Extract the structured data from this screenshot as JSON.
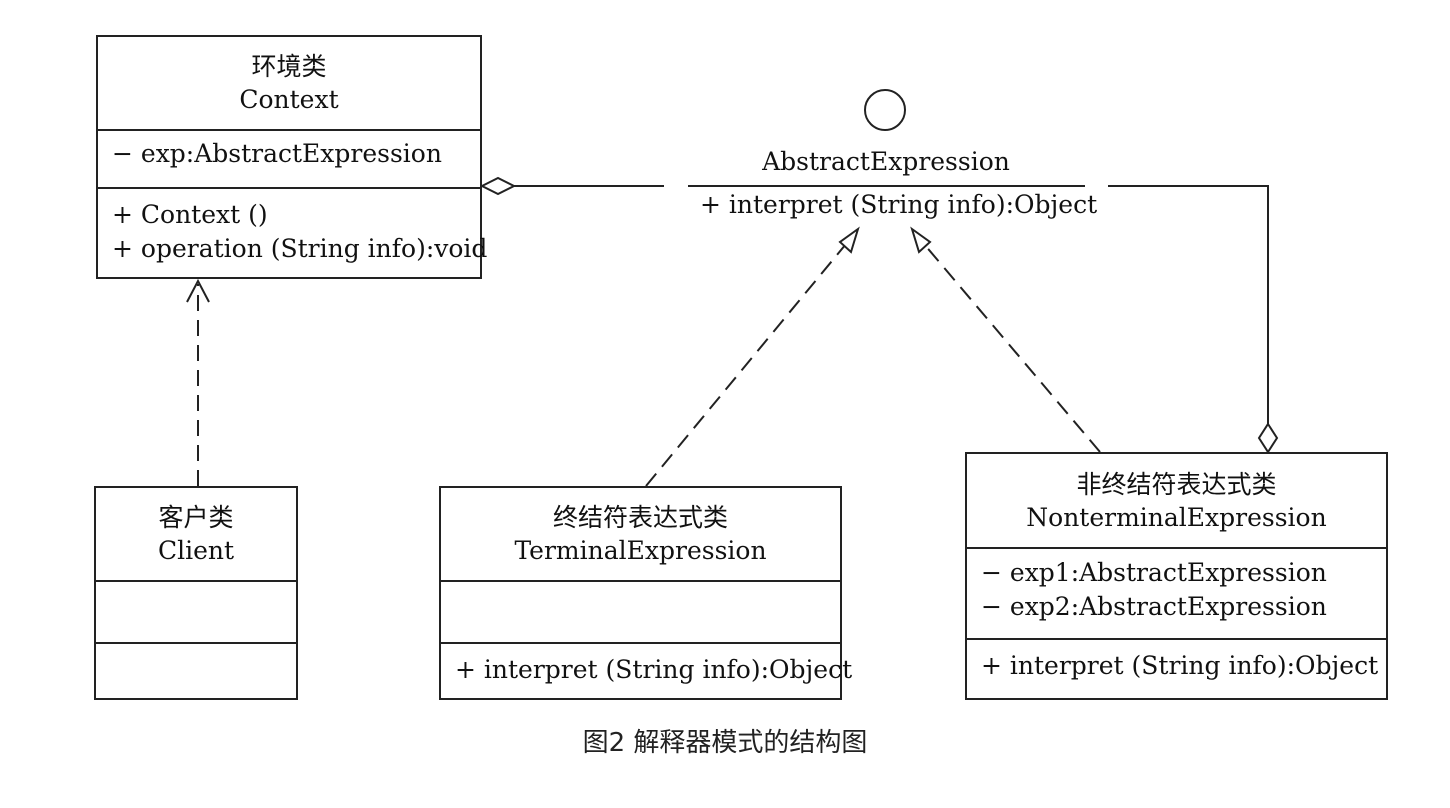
{
  "context": {
    "title_cn": "环境类",
    "title_en": "Context",
    "attributes": [
      "− exp:AbstractExpression"
    ],
    "operations": [
      "+ Context ()",
      "+ operation (String info):void"
    ]
  },
  "client": {
    "title_cn": "客户类",
    "title_en": "Client"
  },
  "abstract_expression": {
    "name": "AbstractExpression",
    "operation": "+ interpret (String info):Object"
  },
  "terminal": {
    "title_cn": "终结符表达式类",
    "title_en": "TerminalExpression",
    "operations": [
      "+ interpret (String info):Object"
    ]
  },
  "nonterminal": {
    "title_cn": "非终结符表达式类",
    "title_en": "NonterminalExpression",
    "attributes": [
      "− exp1:AbstractExpression",
      "− exp2:AbstractExpression"
    ],
    "operations": [
      "+ interpret (String info):Object"
    ]
  },
  "caption": "图2 解释器模式的结构图",
  "colors": {
    "line": "#222222",
    "background": "#ffffff",
    "caption": "#222222"
  }
}
